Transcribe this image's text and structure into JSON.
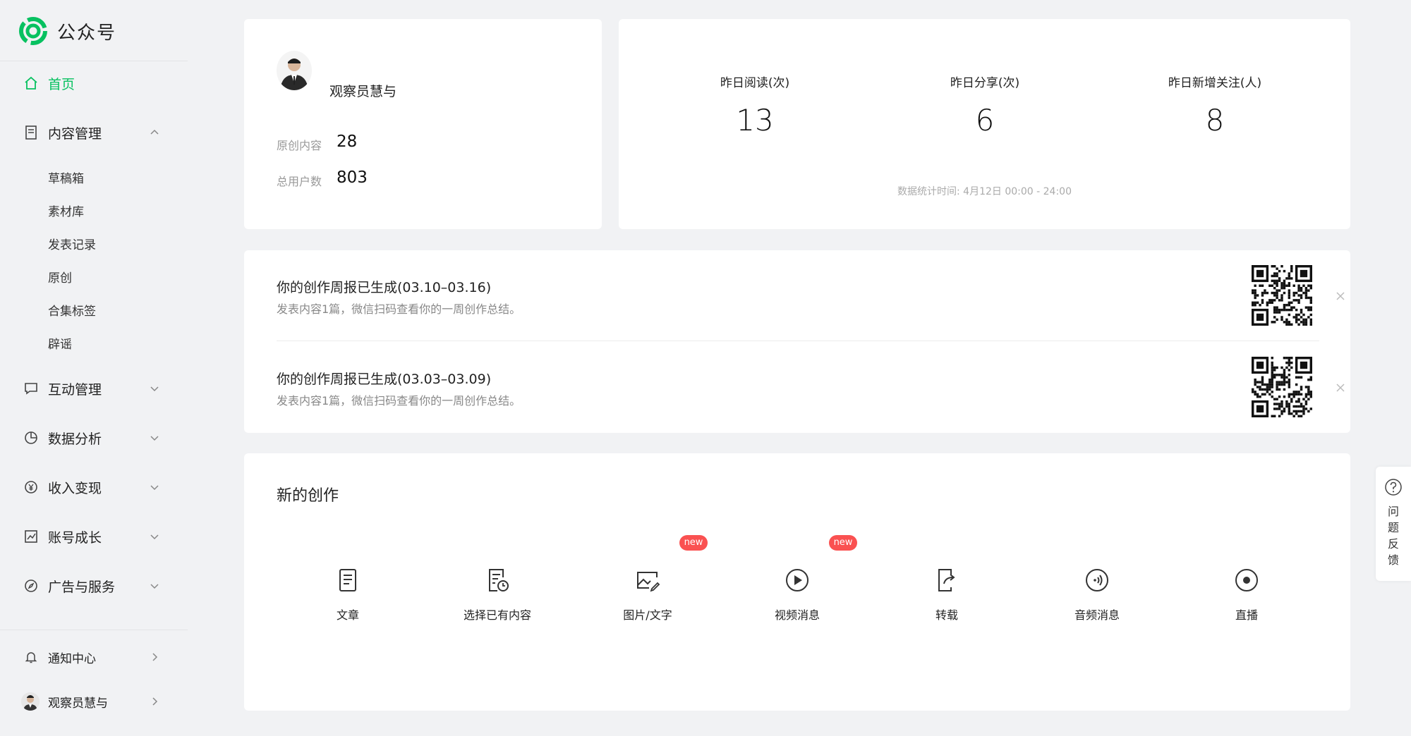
{
  "brand": {
    "name": "公众号"
  },
  "sidebar": {
    "home": {
      "label": "首页",
      "icon": "home-icon"
    },
    "content": {
      "label": "内容管理",
      "icon": "document-icon",
      "sub_items": [
        "草稿箱",
        "素材库",
        "发表记录",
        "原创",
        "合集标签",
        "辟谣"
      ]
    },
    "interaction": {
      "label": "互动管理",
      "icon": "message-icon"
    },
    "analytics": {
      "label": "数据分析",
      "icon": "pie-chart-icon"
    },
    "monetize": {
      "label": "收入变现",
      "icon": "yuan-icon"
    },
    "growth": {
      "label": "账号成长",
      "icon": "trend-chart-icon"
    },
    "ads": {
      "label": "广告与服务",
      "icon": "compass-icon"
    },
    "notifications": {
      "label": "通知中心",
      "icon": "bell-icon"
    },
    "account": {
      "label": "观察员慧与"
    }
  },
  "profile": {
    "name": "观察员慧与",
    "original_label": "原创内容",
    "original_value": "28",
    "users_label": "总用户数",
    "users_value": "803"
  },
  "stats": {
    "reads_label": "昨日阅读(次)",
    "reads_value": "13",
    "shares_label": "昨日分享(次)",
    "shares_value": "6",
    "follows_label": "昨日新增关注(人)",
    "follows_value": "8",
    "time_note": "数据统计时间: 4月12日 00:00 - 24:00"
  },
  "notices": [
    {
      "title": "你的创作周报已生成(03.10–03.16)",
      "desc": "发表内容1篇，微信扫码查看你的一周创作总结。"
    },
    {
      "title": "你的创作周报已生成(03.03–03.09)",
      "desc": "发表内容1篇，微信扫码查看你的一周创作总结。"
    }
  ],
  "create": {
    "title": "新的创作",
    "new_badge": "new",
    "tools": [
      {
        "label": "文章",
        "icon": "article-icon"
      },
      {
        "label": "选择已有内容",
        "icon": "existing-content-icon"
      },
      {
        "label": "图片/文字",
        "icon": "image-text-icon"
      },
      {
        "label": "视频消息",
        "icon": "video-play-icon"
      },
      {
        "label": "转载",
        "icon": "repost-icon"
      },
      {
        "label": "音频消息",
        "icon": "audio-icon"
      },
      {
        "label": "直播",
        "icon": "live-icon"
      }
    ]
  },
  "feedback": {
    "chars": [
      "问",
      "题",
      "反",
      "馈"
    ],
    "icon": "question-icon"
  },
  "colors": {
    "accent": "#07c160",
    "badge": "#fa5151",
    "background": "#f1f2f4"
  }
}
